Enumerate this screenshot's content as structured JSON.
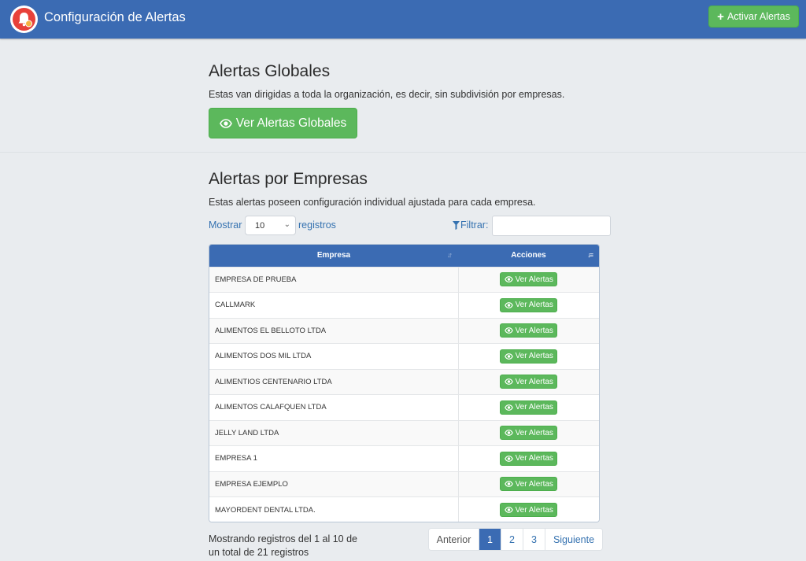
{
  "header": {
    "title": "Configuración de Alertas",
    "activate_label": "Activar Alertas"
  },
  "global_section": {
    "heading": "Alertas Globales",
    "description": "Estas van dirigidas a toda la organización, es decir, sin subdivisión por empresas.",
    "button_label": "Ver Alertas Globales"
  },
  "company_section": {
    "heading": "Alertas por Empresas",
    "description": "Estas alertas poseen configuración individual ajustada para cada empresa.",
    "length_prefix": "Mostrar",
    "length_value": "10",
    "length_suffix": "registros",
    "filter_label": "Filtrar:",
    "filter_value": ""
  },
  "table": {
    "columns": [
      "Empresa",
      "Acciones"
    ],
    "action_label": "Ver Alertas",
    "rows": [
      "EMPRESA DE PRUEBA",
      "CALLMARK",
      "ALIMENTOS EL BELLOTO LTDA",
      "ALIMENTOS DOS MIL LTDA",
      "ALIMENTIOS CENTENARIO LTDA",
      "ALIMENTOS CALAFQUEN LTDA",
      "JELLY LAND LTDA",
      "EMPRESA 1",
      "EMPRESA EJEMPLO",
      "MAYORDENT DENTAL LTDA."
    ]
  },
  "footer": {
    "info": "Mostrando registros del 1 al 10 de un total de 21 registros",
    "prev_label": "Anterior",
    "pages": [
      "1",
      "2",
      "3"
    ],
    "active_page": "1",
    "next_label": "Siguiente"
  },
  "colors": {
    "navbar": "#3b6bb3",
    "success": "#5cb85c",
    "link": "#3572b0",
    "background": "#e9ecef"
  }
}
